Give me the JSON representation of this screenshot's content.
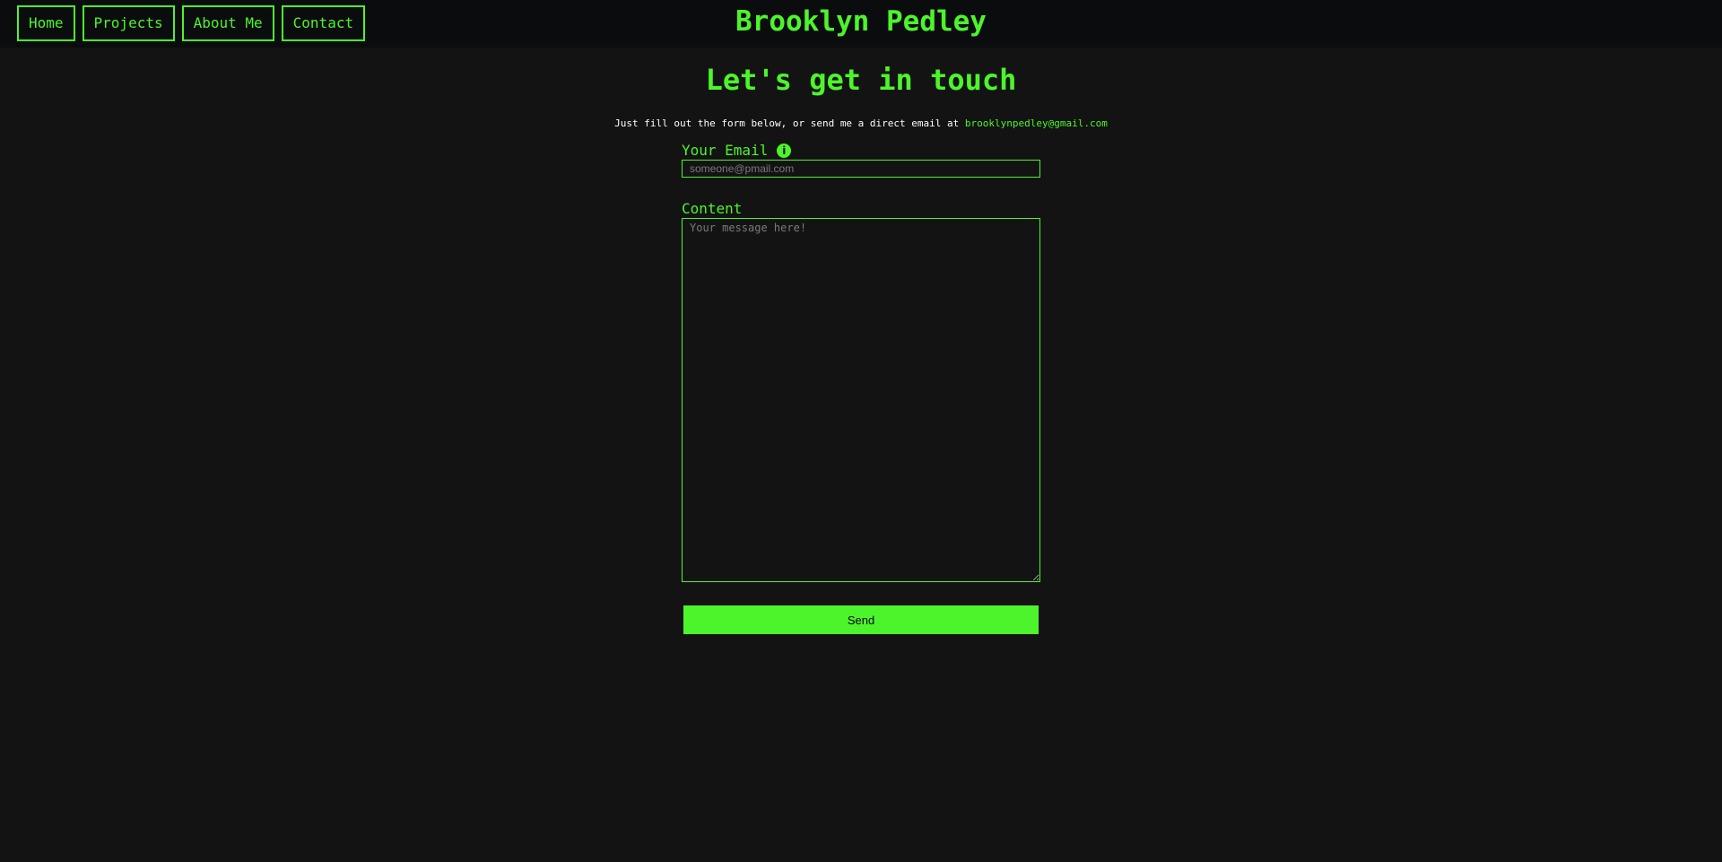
{
  "header": {
    "site_title": "Brooklyn Pedley",
    "nav": [
      {
        "label": "Home"
      },
      {
        "label": "Projects"
      },
      {
        "label": "About Me"
      },
      {
        "label": "Contact"
      }
    ]
  },
  "main": {
    "title": "Let's get in touch",
    "intro_text": "Just fill out the form below, or send me a direct email at ",
    "intro_email": "brooklynpedley@gmail.com",
    "form": {
      "email_label": "Your Email",
      "email_info_icon": "info-icon",
      "email_placeholder": "someone@pmail.com",
      "content_label": "Content",
      "content_placeholder": "Your message here!",
      "send_label": "Send"
    }
  },
  "colors": {
    "accent": "#4cf52b",
    "background": "#131313",
    "header_background": "#0b0c0e",
    "intro_text": "#ffffff"
  }
}
